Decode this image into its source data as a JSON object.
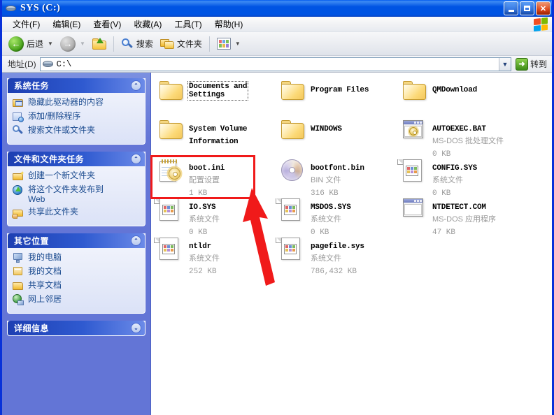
{
  "window": {
    "title": "SYS (C:)",
    "buttons": {
      "minimize": "_",
      "maximize": "□",
      "close": "✕"
    }
  },
  "menu": [
    {
      "label": "文件(F)"
    },
    {
      "label": "编辑(E)"
    },
    {
      "label": "查看(V)"
    },
    {
      "label": "收藏(A)"
    },
    {
      "label": "工具(T)"
    },
    {
      "label": "帮助(H)"
    }
  ],
  "toolbar": {
    "back_label": "后退",
    "forward_label": "",
    "up_label": "",
    "search_label": "搜索",
    "folders_label": "文件夹",
    "views_label": ""
  },
  "address": {
    "label": "地址(D)",
    "value": "C:\\",
    "go_label": "转到"
  },
  "sidebar": {
    "panels": [
      {
        "title": "系统任务",
        "collapsed": false,
        "chevron": "⌃",
        "items": [
          {
            "label": "隐藏此驱动器的内容",
            "icon": "folder-window-icon"
          },
          {
            "label": "添加/删除程序",
            "icon": "add-remove-programs-icon"
          },
          {
            "label": "搜索文件或文件夹",
            "icon": "search-icon"
          }
        ]
      },
      {
        "title": "文件和文件夹任务",
        "collapsed": false,
        "chevron": "⌃",
        "items": [
          {
            "label": "创建一个新文件夹",
            "icon": "new-folder-icon"
          },
          {
            "label": "将这个文件夹发布到\nWeb",
            "icon": "publish-web-icon"
          },
          {
            "label": "共享此文件夹",
            "icon": "share-folder-icon"
          }
        ]
      },
      {
        "title": "其它位置",
        "collapsed": false,
        "chevron": "⌃",
        "items": [
          {
            "label": "我的电脑",
            "icon": "my-computer-icon"
          },
          {
            "label": "我的文档",
            "icon": "my-documents-icon"
          },
          {
            "label": "共享文档",
            "icon": "shared-documents-icon"
          },
          {
            "label": "网上邻居",
            "icon": "network-places-icon"
          }
        ]
      },
      {
        "title": "详细信息",
        "collapsed": true,
        "chevron": "⌄",
        "items": []
      }
    ]
  },
  "filelist": {
    "columns": [
      {
        "items": [
          {
            "name": "Documents and\nSettings",
            "type": "",
            "size": "",
            "icon": "folder-icon",
            "focused": true,
            "highlighted": false
          },
          {
            "name": "System Volume\nInformation",
            "type": "",
            "size": "",
            "icon": "folder-icon",
            "focused": false,
            "highlighted": false
          },
          {
            "name": "boot.ini",
            "type": "配置设置",
            "size": "1 KB",
            "icon": "config-settings-icon",
            "focused": false,
            "highlighted": true
          },
          {
            "name": "IO.SYS",
            "type": "系统文件",
            "size": "0 KB",
            "icon": "system-file-icon",
            "focused": false,
            "highlighted": false
          },
          {
            "name": "ntldr",
            "type": "系统文件",
            "size": "252 KB",
            "icon": "system-file-icon",
            "focused": false,
            "highlighted": false
          }
        ]
      },
      {
        "items": [
          {
            "name": "Program Files",
            "type": "",
            "size": "",
            "icon": "folder-icon",
            "focused": false,
            "highlighted": false
          },
          {
            "name": "WINDOWS",
            "type": "",
            "size": "",
            "icon": "folder-icon",
            "focused": false,
            "highlighted": false
          },
          {
            "name": "bootfont.bin",
            "type": "BIN 文件",
            "size": "316 KB",
            "icon": "bin-file-icon",
            "focused": false,
            "highlighted": false
          },
          {
            "name": "MSDOS.SYS",
            "type": "系统文件",
            "size": "0 KB",
            "icon": "system-file-icon",
            "focused": false,
            "highlighted": false
          },
          {
            "name": "pagefile.sys",
            "type": "系统文件",
            "size": "786,432 KB",
            "icon": "system-file-icon",
            "focused": false,
            "highlighted": false
          }
        ]
      },
      {
        "items": [
          {
            "name": "QMDownload",
            "type": "",
            "size": "",
            "icon": "folder-icon",
            "focused": false,
            "highlighted": false
          },
          {
            "name": "AUTOEXEC.BAT",
            "type": "MS-DOS 批处理文件",
            "size": "0 KB",
            "icon": "ms-dos-batch-icon",
            "focused": false,
            "highlighted": false
          },
          {
            "name": "CONFIG.SYS",
            "type": "系统文件",
            "size": "0 KB",
            "icon": "system-file-icon",
            "focused": false,
            "highlighted": false
          },
          {
            "name": "NTDETECT.COM",
            "type": "MS-DOS 应用程序",
            "size": "47 KB",
            "icon": "ms-dos-application-icon",
            "focused": false,
            "highlighted": false
          }
        ]
      }
    ]
  },
  "annotations": {
    "highlight_color": "#f01a1a",
    "target": "boot.ini"
  }
}
